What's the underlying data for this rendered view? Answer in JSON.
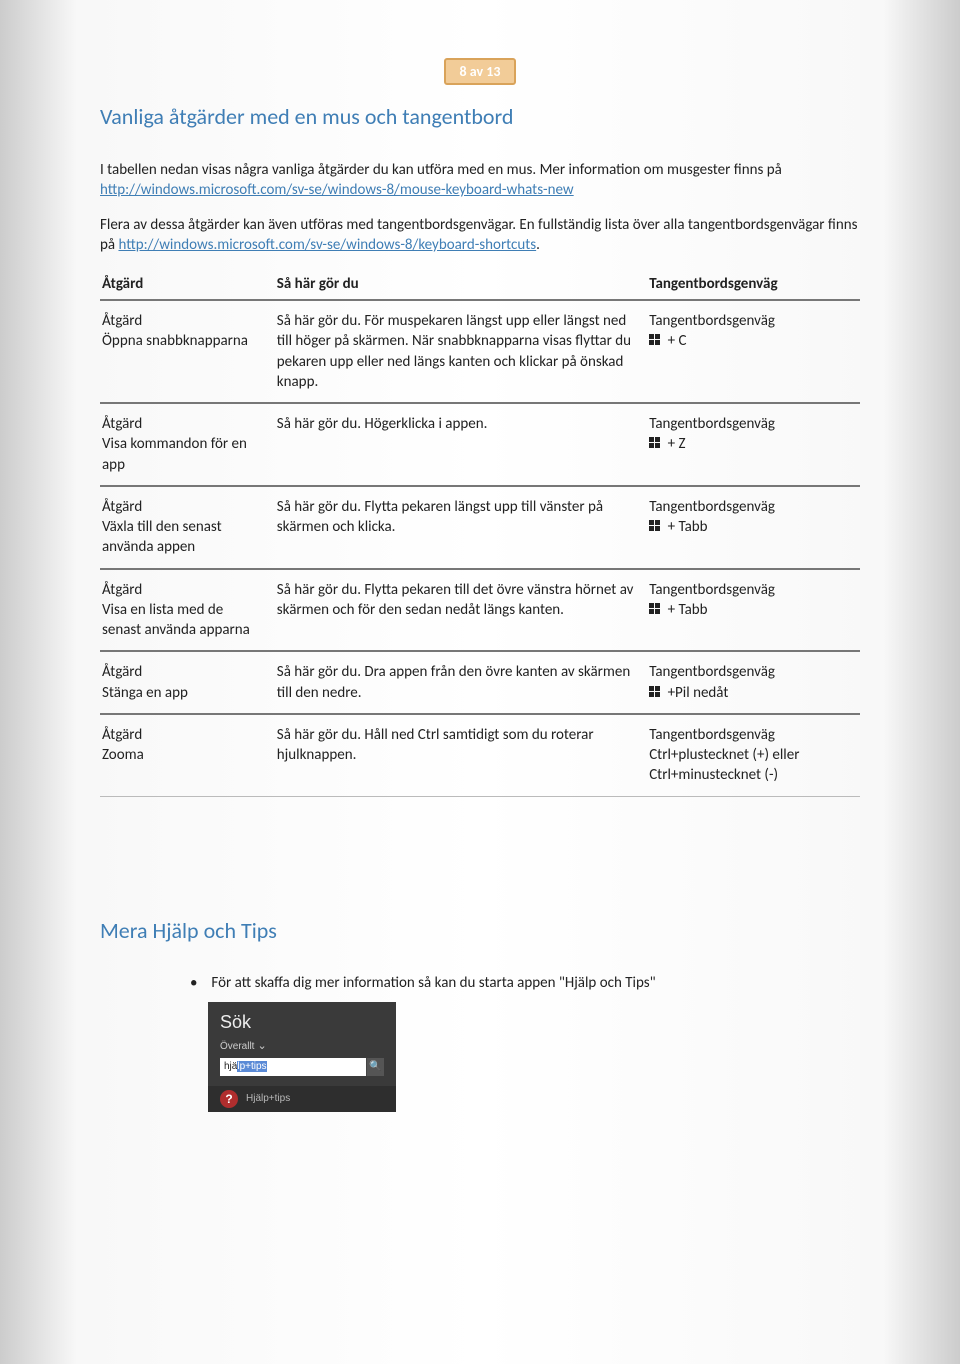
{
  "page_badge": "8 av 13",
  "heading1": "Vanliga åtgärder med en mus och tangentbord",
  "intro_pre": "I tabellen nedan visas några vanliga åtgärder du kan utföra med en mus. Mer information om musgester finns på ",
  "intro_link1": "http://windows.microsoft.com/sv-se/windows-8/mouse-keyboard-whats-new",
  "intro2_pre": "Flera av dessa åtgärder kan även utföras med tangentbordsgenvägar. En fullständig lista över alla tangentbordsgenvägar finns på ",
  "intro2_link": "http://windows.microsoft.com/sv-se/windows-8/keyboard-shortcuts",
  "intro2_post": ".",
  "table": {
    "h1": "Åtgärd",
    "h2": "Så här gör du",
    "h3": "Tangentbordsgenväg",
    "action_label": "Åtgärd",
    "howto_label": "Så här gör du.",
    "shortcut_label": "Tangentbordsgenväg",
    "rows": [
      {
        "action": "Öppna snabbknapparna",
        "howto": "För muspekaren längst upp eller längst ned till höger på skärmen. När snabbknapparna visas flyttar du pekaren upp eller ned längs kanten och klickar på önskad knapp.",
        "shortcut_key": "+ C"
      },
      {
        "action": "Visa kommandon för en app",
        "howto": "Högerklicka i appen.",
        "shortcut_key": "+ Z"
      },
      {
        "action": "Växla till den senast använda appen",
        "howto": "Flytta pekaren längst upp till vänster på skärmen och klicka.",
        "shortcut_key": "+ Tabb"
      },
      {
        "action": "Visa en lista med de senast använda apparna",
        "howto": "Flytta pekaren till det övre vänstra hörnet av skärmen och för den sedan nedåt längs kanten.",
        "shortcut_key": "+ Tabb"
      },
      {
        "action": "Stänga en app",
        "howto": "Dra appen från den övre kanten av skärmen till den nedre.",
        "shortcut_key": "+Pil nedåt"
      },
      {
        "action": "Zooma",
        "howto": "Håll ned Ctrl samtidigt som du roterar hjulknappen.",
        "shortcut_text": "Ctrl+plustecknet (+) eller Ctrl+minustecknet (-)"
      }
    ]
  },
  "heading2": "Mera Hjälp och Tips",
  "bullet1": "För att skaffa dig mer information så kan du starta appen \"Hjälp och Tips\"",
  "search_panel": {
    "title": "Sök",
    "scope": "Överallt",
    "typed_plain": "hjä",
    "typed_hl": "lp+tips",
    "search_icon": "🔍",
    "result_text": "Hjälp+tips"
  }
}
